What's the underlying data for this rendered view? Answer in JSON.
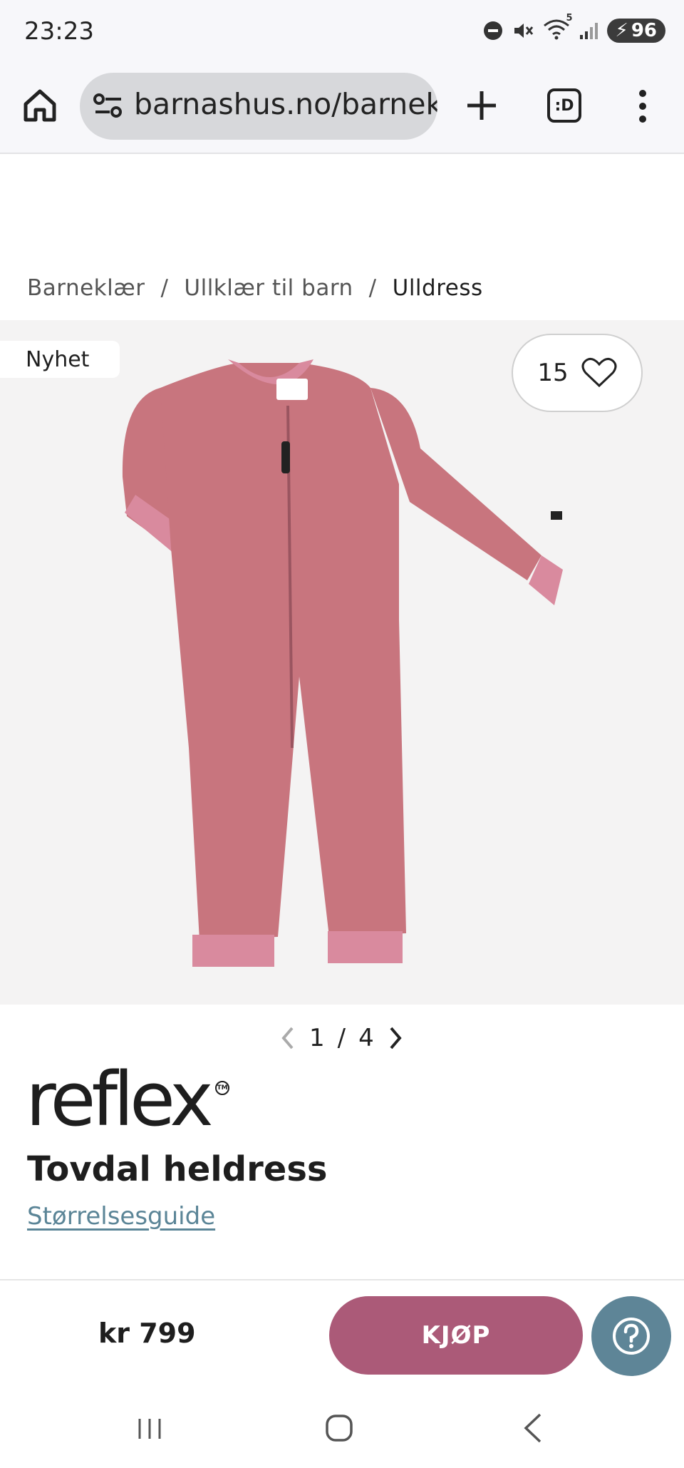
{
  "status_bar": {
    "time": "23:23",
    "signal_badge": "5",
    "battery": "96"
  },
  "browser": {
    "url": "barnashus.no/barneklær/ullklær-til-barn/ulldress",
    "tabs_icon_text": ":D"
  },
  "breadcrumb": {
    "items": [
      "Barneklær",
      "Ullklær til barn",
      "Ulldress"
    ],
    "separator": "/"
  },
  "gallery": {
    "badge": "Nyhet",
    "favorites_count": "15",
    "current": "1",
    "total": "4",
    "sep": "/"
  },
  "product": {
    "brand": "reflex",
    "tm": "TM",
    "title": "Tovdal heldress",
    "size_guide": "Størrelsesguide",
    "price": "kr 799",
    "color": "#c8757e"
  },
  "actions": {
    "buy_label": "KJØP",
    "accent": "#ab5a78",
    "help_color": "#5e8597"
  }
}
